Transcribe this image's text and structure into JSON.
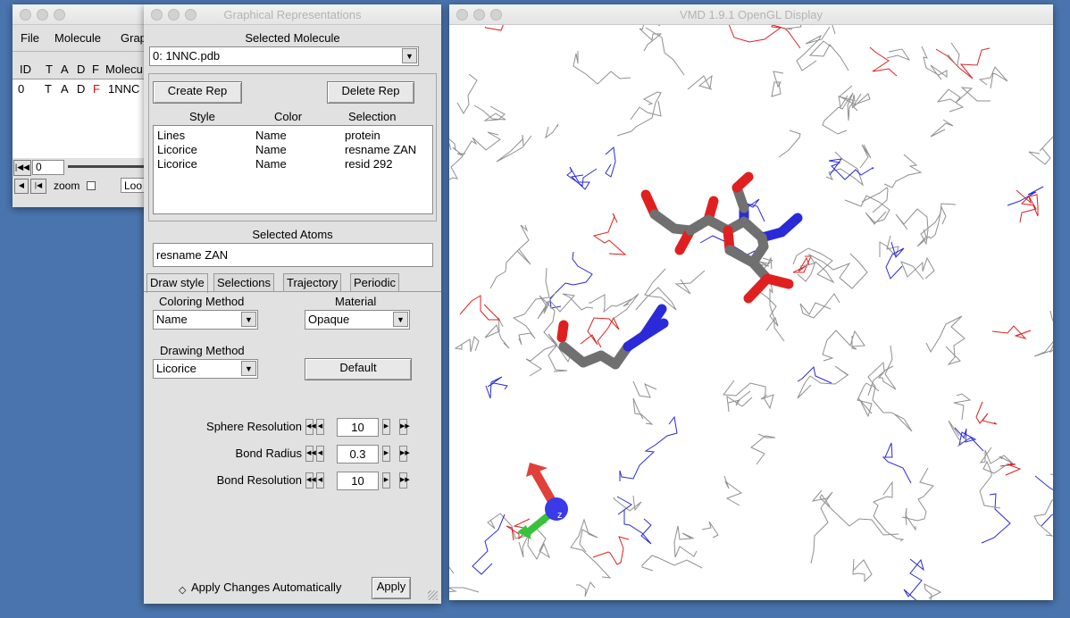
{
  "main_window": {
    "menu": [
      "File",
      "Molecule",
      "Grap"
    ],
    "headers": [
      "ID",
      "T",
      "A",
      "D",
      "F",
      "Molecu"
    ],
    "row": {
      "id": "0",
      "t": "T",
      "a": "A",
      "d": "D",
      "f": "F",
      "name": "1NNC"
    },
    "frame_value": "0",
    "zoom_label": "zoom",
    "loop_label": "Loo"
  },
  "reps_window": {
    "title": "Graphical Representations",
    "selected_molecule_label": "Selected Molecule",
    "selected_molecule": "0: 1NNC.pdb",
    "create_rep": "Create Rep",
    "delete_rep": "Delete Rep",
    "table_headers": {
      "style": "Style",
      "color": "Color",
      "selection": "Selection"
    },
    "reps": [
      {
        "style": "Lines",
        "color": "Name",
        "selection": "protein"
      },
      {
        "style": "Licorice",
        "color": "Name",
        "selection": "resname ZAN"
      },
      {
        "style": "Licorice",
        "color": "Name",
        "selection": "resid 292"
      }
    ],
    "selected_atoms_label": "Selected Atoms",
    "selected_atoms": "resname ZAN",
    "tabs": [
      "Draw style",
      "Selections",
      "Trajectory",
      "Periodic"
    ],
    "coloring_method_label": "Coloring Method",
    "coloring_method": "Name",
    "material_label": "Material",
    "material": "Opaque",
    "drawing_method_label": "Drawing Method",
    "drawing_method": "Licorice",
    "default_button": "Default",
    "sphere_resolution_label": "Sphere Resolution",
    "sphere_resolution": "10",
    "bond_radius_label": "Bond Radius",
    "bond_radius": "0.3",
    "bond_resolution_label": "Bond Resolution",
    "bond_resolution": "10",
    "apply_auto_label": "Apply Changes Automatically",
    "apply_button": "Apply"
  },
  "display_window": {
    "title": "VMD 1.9.1 OpenGL Display",
    "axis_label": "z"
  },
  "colors": {
    "desktop": "#4a74ad",
    "carbon": "#707070",
    "oxygen": "#e02020",
    "nitrogen": "#2a2ad8",
    "line_gray": "#8f8f8f",
    "axis_x": "#e0403a",
    "axis_y": "#37c23a",
    "axis_z": "#3a3ae8"
  }
}
